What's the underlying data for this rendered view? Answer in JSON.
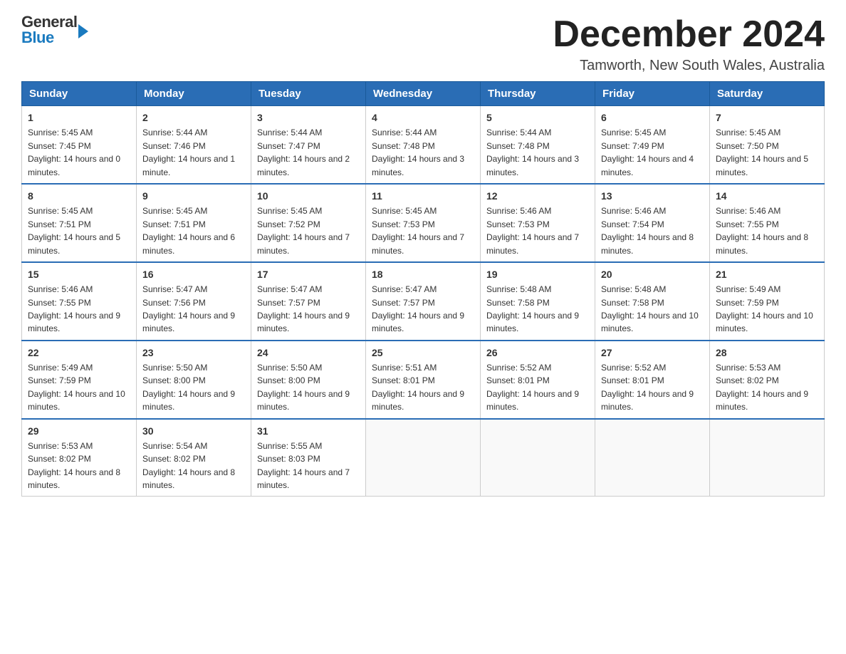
{
  "logo": {
    "general": "General",
    "blue": "Blue"
  },
  "title": "December 2024",
  "location": "Tamworth, New South Wales, Australia",
  "days_of_week": [
    "Sunday",
    "Monday",
    "Tuesday",
    "Wednesday",
    "Thursday",
    "Friday",
    "Saturday"
  ],
  "weeks": [
    [
      {
        "day": "1",
        "sunrise": "5:45 AM",
        "sunset": "7:45 PM",
        "daylight": "14 hours and 0 minutes."
      },
      {
        "day": "2",
        "sunrise": "5:44 AM",
        "sunset": "7:46 PM",
        "daylight": "14 hours and 1 minute."
      },
      {
        "day": "3",
        "sunrise": "5:44 AM",
        "sunset": "7:47 PM",
        "daylight": "14 hours and 2 minutes."
      },
      {
        "day": "4",
        "sunrise": "5:44 AM",
        "sunset": "7:48 PM",
        "daylight": "14 hours and 3 minutes."
      },
      {
        "day": "5",
        "sunrise": "5:44 AM",
        "sunset": "7:48 PM",
        "daylight": "14 hours and 3 minutes."
      },
      {
        "day": "6",
        "sunrise": "5:45 AM",
        "sunset": "7:49 PM",
        "daylight": "14 hours and 4 minutes."
      },
      {
        "day": "7",
        "sunrise": "5:45 AM",
        "sunset": "7:50 PM",
        "daylight": "14 hours and 5 minutes."
      }
    ],
    [
      {
        "day": "8",
        "sunrise": "5:45 AM",
        "sunset": "7:51 PM",
        "daylight": "14 hours and 5 minutes."
      },
      {
        "day": "9",
        "sunrise": "5:45 AM",
        "sunset": "7:51 PM",
        "daylight": "14 hours and 6 minutes."
      },
      {
        "day": "10",
        "sunrise": "5:45 AM",
        "sunset": "7:52 PM",
        "daylight": "14 hours and 7 minutes."
      },
      {
        "day": "11",
        "sunrise": "5:45 AM",
        "sunset": "7:53 PM",
        "daylight": "14 hours and 7 minutes."
      },
      {
        "day": "12",
        "sunrise": "5:46 AM",
        "sunset": "7:53 PM",
        "daylight": "14 hours and 7 minutes."
      },
      {
        "day": "13",
        "sunrise": "5:46 AM",
        "sunset": "7:54 PM",
        "daylight": "14 hours and 8 minutes."
      },
      {
        "day": "14",
        "sunrise": "5:46 AM",
        "sunset": "7:55 PM",
        "daylight": "14 hours and 8 minutes."
      }
    ],
    [
      {
        "day": "15",
        "sunrise": "5:46 AM",
        "sunset": "7:55 PM",
        "daylight": "14 hours and 9 minutes."
      },
      {
        "day": "16",
        "sunrise": "5:47 AM",
        "sunset": "7:56 PM",
        "daylight": "14 hours and 9 minutes."
      },
      {
        "day": "17",
        "sunrise": "5:47 AM",
        "sunset": "7:57 PM",
        "daylight": "14 hours and 9 minutes."
      },
      {
        "day": "18",
        "sunrise": "5:47 AM",
        "sunset": "7:57 PM",
        "daylight": "14 hours and 9 minutes."
      },
      {
        "day": "19",
        "sunrise": "5:48 AM",
        "sunset": "7:58 PM",
        "daylight": "14 hours and 9 minutes."
      },
      {
        "day": "20",
        "sunrise": "5:48 AM",
        "sunset": "7:58 PM",
        "daylight": "14 hours and 10 minutes."
      },
      {
        "day": "21",
        "sunrise": "5:49 AM",
        "sunset": "7:59 PM",
        "daylight": "14 hours and 10 minutes."
      }
    ],
    [
      {
        "day": "22",
        "sunrise": "5:49 AM",
        "sunset": "7:59 PM",
        "daylight": "14 hours and 10 minutes."
      },
      {
        "day": "23",
        "sunrise": "5:50 AM",
        "sunset": "8:00 PM",
        "daylight": "14 hours and 9 minutes."
      },
      {
        "day": "24",
        "sunrise": "5:50 AM",
        "sunset": "8:00 PM",
        "daylight": "14 hours and 9 minutes."
      },
      {
        "day": "25",
        "sunrise": "5:51 AM",
        "sunset": "8:01 PM",
        "daylight": "14 hours and 9 minutes."
      },
      {
        "day": "26",
        "sunrise": "5:52 AM",
        "sunset": "8:01 PM",
        "daylight": "14 hours and 9 minutes."
      },
      {
        "day": "27",
        "sunrise": "5:52 AM",
        "sunset": "8:01 PM",
        "daylight": "14 hours and 9 minutes."
      },
      {
        "day": "28",
        "sunrise": "5:53 AM",
        "sunset": "8:02 PM",
        "daylight": "14 hours and 9 minutes."
      }
    ],
    [
      {
        "day": "29",
        "sunrise": "5:53 AM",
        "sunset": "8:02 PM",
        "daylight": "14 hours and 8 minutes."
      },
      {
        "day": "30",
        "sunrise": "5:54 AM",
        "sunset": "8:02 PM",
        "daylight": "14 hours and 8 minutes."
      },
      {
        "day": "31",
        "sunrise": "5:55 AM",
        "sunset": "8:03 PM",
        "daylight": "14 hours and 7 minutes."
      },
      null,
      null,
      null,
      null
    ]
  ]
}
